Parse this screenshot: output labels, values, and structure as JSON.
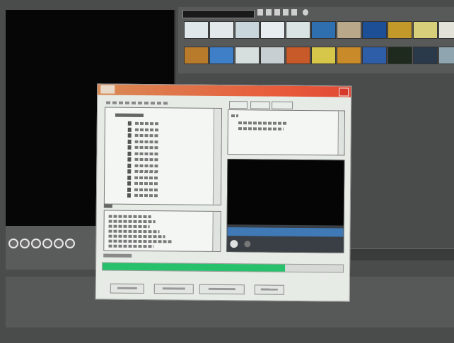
{
  "app": {
    "colors": {
      "preview_bg": "#060606",
      "dialog_bg": "#e6ebe6",
      "titlebar": "#e85c3c",
      "progress": "#27c16c",
      "seek_bar": "#3f79b6"
    },
    "playback_controls_count": 6
  },
  "gallery": {
    "thumbnails": [
      {
        "color": "#dfe7ea"
      },
      {
        "color": "#e3e9ea"
      },
      {
        "color": "#c9d6dc"
      },
      {
        "color": "#e6ecef"
      },
      {
        "color": "#d9e3e3"
      },
      {
        "color": "#2f6fb0"
      },
      {
        "color": "#b9a98a"
      },
      {
        "color": "#1d4f96"
      },
      {
        "color": "#c39a2a"
      },
      {
        "color": "#d8cf7a"
      },
      {
        "color": "#e2e2d8"
      },
      {
        "color": "#b87a2b"
      },
      {
        "color": "#3f7fc8"
      },
      {
        "color": "#d7dede"
      },
      {
        "color": "#c8cfd2"
      },
      {
        "color": "#c85a2a"
      },
      {
        "color": "#d6c64a"
      },
      {
        "color": "#c98a2a"
      },
      {
        "color": "#2f5ea8"
      },
      {
        "color": "#1f2a1f"
      },
      {
        "color": "#2a3a4a"
      },
      {
        "color": "#8fa6b0"
      }
    ]
  },
  "dialog": {
    "progress_fraction": 0.76
  }
}
